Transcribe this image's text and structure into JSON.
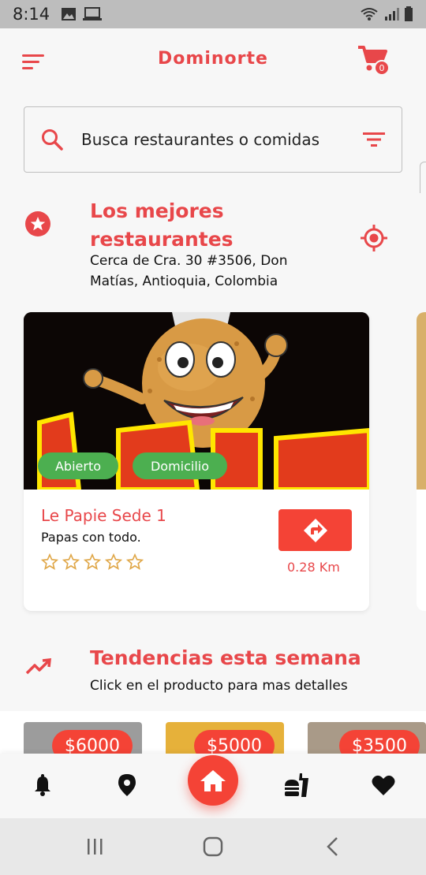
{
  "status_bar": {
    "time": "8:14"
  },
  "app": {
    "brand": "Dominorte",
    "cart_count": "0"
  },
  "search": {
    "placeholder": "Busca restaurantes o comidas"
  },
  "best": {
    "title": "Los mejores restaurantes",
    "location": "Cerca de Cra. 30 #3506, Don Matías, Antioquia, Colombia"
  },
  "restaurant": {
    "name": "Le Papie Sede 1",
    "description": "Papas con todo.",
    "tags": [
      "Abierto",
      "Domicilio"
    ],
    "rating": 0,
    "rating_max": 5,
    "distance": "0.28 Km"
  },
  "trending": {
    "title": "Tendencias esta semana",
    "subtitle": "Click en el producto para mas detalles",
    "products": [
      {
        "price": "$6000"
      },
      {
        "price": "$5000"
      },
      {
        "price": "$3500"
      }
    ]
  },
  "colors": {
    "accent": "#e8474a",
    "button": "#f44336",
    "tag": "#4caf50",
    "star": "#e0a84a"
  },
  "icons": {
    "menu": "menu-icon",
    "cart": "cart-icon",
    "search": "search-icon",
    "filter": "filter-icon",
    "star_badge": "star-icon",
    "target": "gps-target-icon",
    "directions": "directions-icon",
    "trend": "trending-up-icon",
    "bell": "bell-icon",
    "location": "location-pin-icon",
    "home": "home-icon",
    "food": "fastfood-icon",
    "heart": "heart-icon"
  }
}
